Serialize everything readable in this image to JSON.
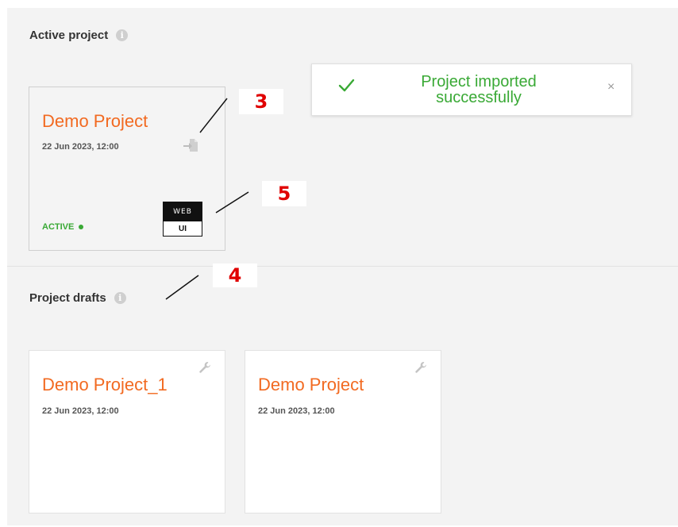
{
  "sections": {
    "active": {
      "title": "Active project",
      "info_icon": "info-icon"
    },
    "drafts": {
      "title": "Project drafts",
      "info_icon": "info-icon"
    }
  },
  "active_card": {
    "title": "Demo Project",
    "date": "22 Jun 2023, 12:00",
    "status": "ACTIVE",
    "badge": {
      "top": "WEB",
      "bottom": "UI"
    },
    "action_icon": "import-file-icon"
  },
  "draft_cards": [
    {
      "title": "Demo Project_1",
      "date": "22 Jun 2023, 12:00",
      "action_icon": "wrench-icon"
    },
    {
      "title": "Demo Project",
      "date": "22 Jun 2023, 12:00",
      "action_icon": "wrench-icon"
    }
  ],
  "toast": {
    "message_line1": "Project imported",
    "message_line2": "successfully",
    "icon": "checkmark-icon",
    "close": "×"
  },
  "callouts": {
    "c3": "3",
    "c4": "4",
    "c5": "5"
  },
  "colors": {
    "accent": "#f26a21",
    "success": "#39a935",
    "callout": "#e00000",
    "panel_bg": "#f3f3f3"
  }
}
